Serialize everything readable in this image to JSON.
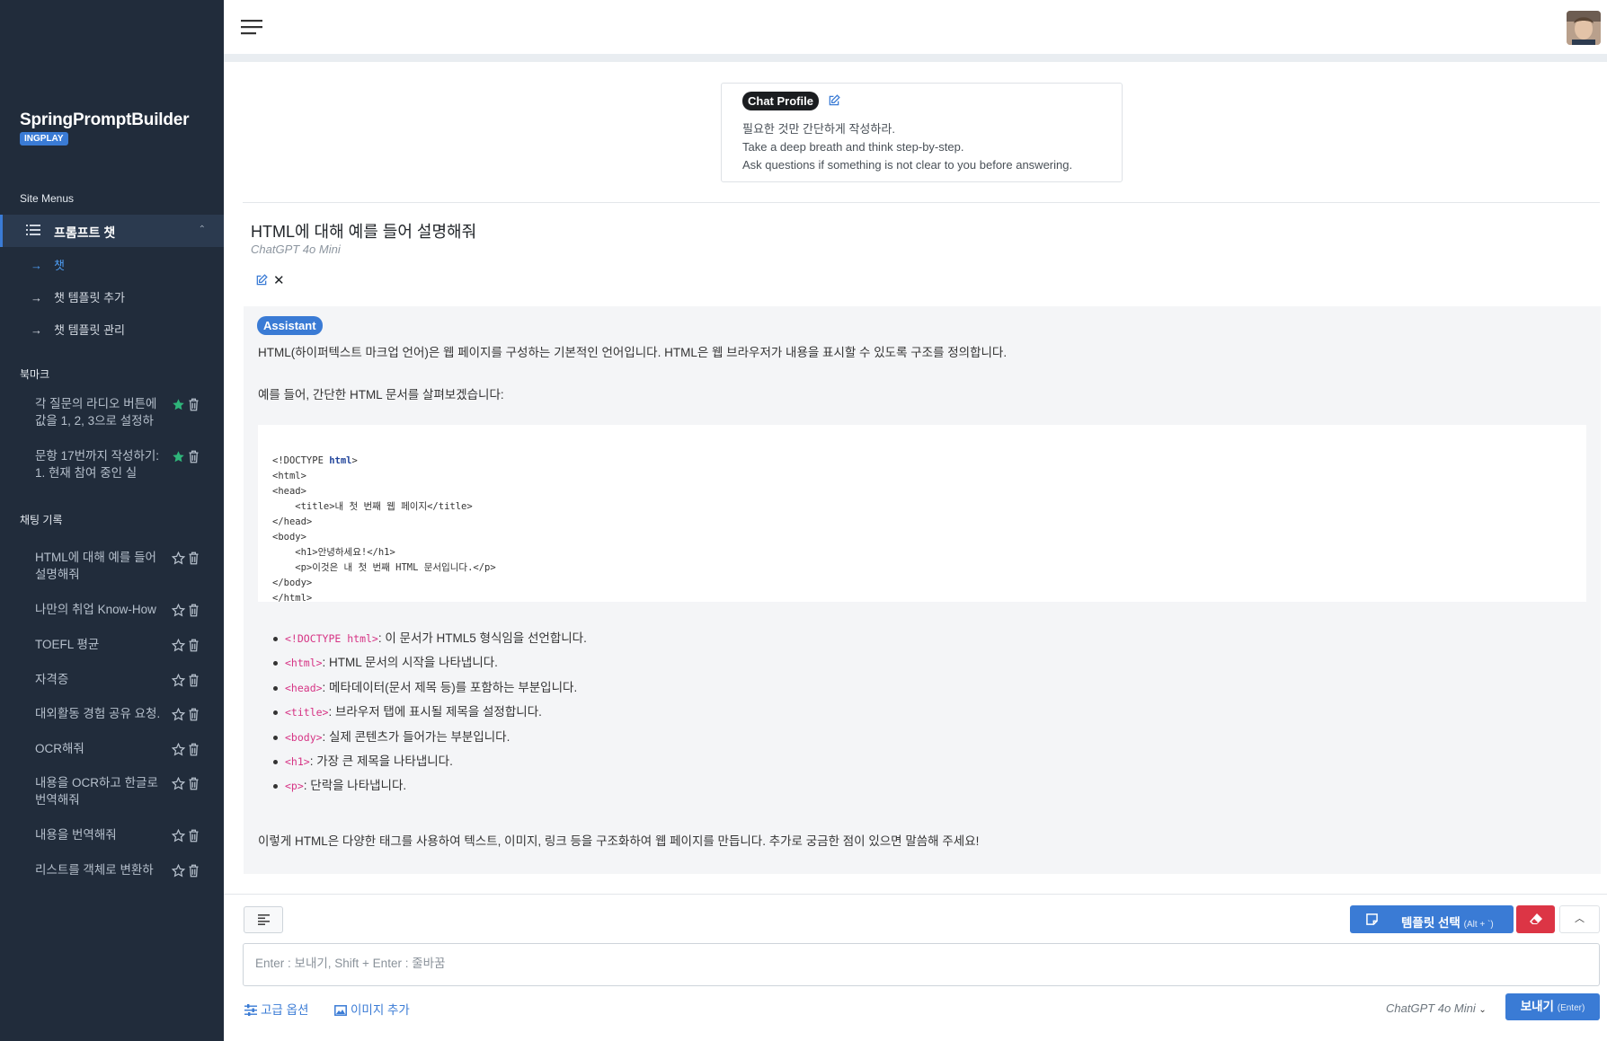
{
  "sidebar": {
    "brand": "SpringPromptBuilder",
    "badge": "INGPLAY",
    "site_menus_title": "Site Menus",
    "active_menu": "프롬프트 챗",
    "submenu": [
      "챗",
      "챗 템플릿 추가",
      "챗 템플릿 관리"
    ],
    "bookmark_title": "북마크",
    "bookmarks": [
      {
        "label": "각 질문의 라디오 버튼에 값을 1, 2, 3으로 설정하",
        "starred": true
      },
      {
        "label": "문항 17번까지 작성하기: 1. 현재 참여 중인 실",
        "starred": true
      }
    ],
    "history_title": "채팅 기록",
    "history": [
      {
        "label": "HTML에 대해 예를 들어 설명해줘"
      },
      {
        "label": "나만의 취업 Know-How"
      },
      {
        "label": "TOEFL 평균"
      },
      {
        "label": "자격증"
      },
      {
        "label": "대외활동 경험 공유 요청."
      },
      {
        "label": "OCR해줘"
      },
      {
        "label": "내용을 OCR하고 한글로 번역해줘"
      },
      {
        "label": "내용을 번역해줘"
      },
      {
        "label": "리스트를 객체로 변환하"
      }
    ]
  },
  "profile": {
    "label": "Chat Profile",
    "lines": [
      "필요한 것만 간단하게 작성하라.",
      "Take a deep breath and think step-by-step.",
      "Ask questions if something is not clear to you before answering."
    ]
  },
  "question": {
    "title": "HTML에 대해 예를 들어 설명해줘",
    "model": "ChatGPT 4o Mini"
  },
  "answer": {
    "role": "Assistant",
    "intro": "HTML(하이퍼텍스트 마크업 언어)은 웹 페이지를 구성하는 기본적인 언어입니다. HTML은 웹 브라우저가 내용을 표시할 수 있도록 구조를 정의합니다.",
    "example_intro": "예를 들어, 간단한 HTML 문서를 살펴보겠습니다:",
    "code_lines": [
      "<!DOCTYPE html>",
      "<html>",
      "<head>",
      "    <title>내 첫 번째 웹 페이지</title>",
      "</head>",
      "<body>",
      "    <h1>안녕하세요!</h1>",
      "    <p>이것은 내 첫 번째 HTML 문서입니다.</p>",
      "</body>",
      "</html>"
    ],
    "bullets": [
      {
        "tag": "<!DOCTYPE html>",
        "text": ": 이 문서가 HTML5 형식임을 선언합니다."
      },
      {
        "tag": "<html>",
        "text": ": HTML 문서의 시작을 나타냅니다."
      },
      {
        "tag": "<head>",
        "text": ": 메타데이터(문서 제목 등)를 포함하는 부분입니다."
      },
      {
        "tag": "<title>",
        "text": ": 브라우저 탭에 표시될 제목을 설정합니다."
      },
      {
        "tag": "<body>",
        "text": ": 실제 콘텐츠가 들어가는 부분입니다."
      },
      {
        "tag": "<h1>",
        "text": ": 가장 큰 제목을 나타냅니다."
      },
      {
        "tag": "<p>",
        "text": ": 단락을 나타냅니다."
      }
    ],
    "closing": "이렇게 HTML은 다양한 태그를 사용하여 텍스트, 이미지, 링크 등을 구조화하여 웹 페이지를 만듭니다. 추가로 궁금한 점이 있으면 말씀해 주세요!"
  },
  "composer": {
    "template_button": "템플릿 선택",
    "template_shortcut": "(Alt + `)",
    "placeholder": "Enter : 보내기, Shift + Enter : 줄바꿈",
    "advanced": "고급 옵션",
    "add_image": "이미지 추가",
    "model": "ChatGPT 4o Mini",
    "send": "보내기",
    "send_shortcut": "(Enter)"
  },
  "colors": {
    "sidebar_bg": "#212c3b",
    "accent": "#3a7bd5",
    "danger": "#dc3545",
    "star": "#2fb57a"
  }
}
